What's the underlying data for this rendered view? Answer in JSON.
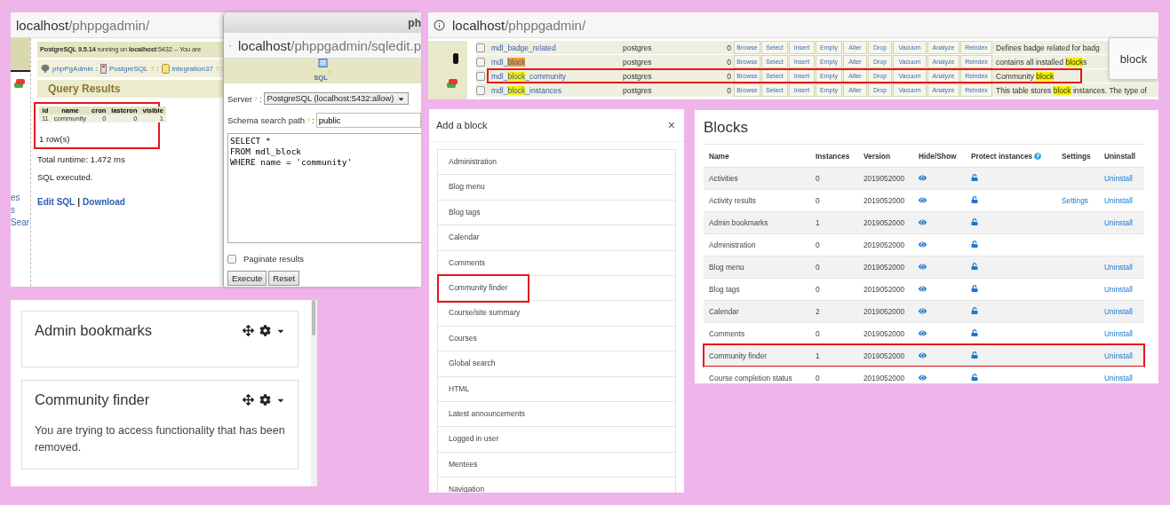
{
  "query_window": {
    "address": {
      "host": "localhost",
      "path": "/phppgadmin/"
    },
    "sidebar_fragments": [
      "es",
      "s",
      "Sear"
    ],
    "banner": "**PostgreSQL 9.5.14** running on **localhost**:5432 -- You are",
    "breadcrumbs": [
      {
        "kind": "app",
        "label": "phpPgAdmin",
        "suffix": ":"
      },
      {
        "kind": "server",
        "label": "PostgreSQL",
        "help": "?",
        "suffix": ":"
      },
      {
        "kind": "database",
        "label": "integration37",
        "help": "?",
        "suffix": ":"
      }
    ],
    "heading": "Query Results",
    "results": {
      "annotated": true,
      "columns": [
        "id",
        "name",
        "cron",
        "lastcron",
        "visible"
      ],
      "rows": [
        [
          "11",
          "community",
          "0",
          "0",
          "1"
        ]
      ],
      "row_count": "1 row(s)"
    },
    "runtime": "Total runtime: 1.472 ms",
    "status": "SQL executed.",
    "links": [
      "Edit SQL",
      "Download"
    ],
    "link_separator": "|"
  },
  "sql_window": {
    "title": "ph",
    "address": {
      "host": "localhost",
      "path": "/phppgadmin/sqledit.p"
    },
    "toolbar": {
      "label": "SQL",
      "help": "?"
    },
    "server": {
      "label": "Server",
      "help": "?",
      "suffix": ":",
      "value": "PostgreSQL (localhost:5432:allow)"
    },
    "schema": {
      "label": "Schema search path",
      "help": "?",
      "suffix": ":",
      "value": "public"
    },
    "query": "SELECT *\nFROM mdl_block\nWHERE name = 'community'",
    "paginate": {
      "label": "Paginate results",
      "checked": false
    },
    "buttons": [
      "Execute",
      "Reset"
    ]
  },
  "tables_window": {
    "address": {
      "host": "localhost",
      "path": "/phppgadmin/"
    },
    "find_text": "block",
    "rows": [
      {
        "checked": false,
        "annotated": false,
        "name": [
          {
            "text": "mdl_badge_related",
            "match": false
          }
        ],
        "owner": "postgres",
        "count": "0",
        "actions": [
          "Browse",
          "Select",
          "Insert",
          "Empty",
          "Alter",
          "Drop",
          "Vacuum",
          "Analyze",
          "Reindex"
        ],
        "comment": [
          {
            "text": "Defines badge related for badg",
            "match": false
          }
        ]
      },
      {
        "checked": false,
        "annotated": false,
        "name": [
          {
            "text": "mdl_",
            "match": false
          },
          {
            "text": "block",
            "match": true,
            "current": true
          }
        ],
        "owner": "postgres",
        "count": "0",
        "actions": [
          "Browse",
          "Select",
          "Insert",
          "Empty",
          "Alter",
          "Drop",
          "Vacuum",
          "Analyze",
          "Reindex"
        ],
        "comment": [
          {
            "text": "contains all installed ",
            "match": false
          },
          {
            "text": "block",
            "match": true,
            "current": false
          },
          {
            "text": "s",
            "match": false
          }
        ]
      },
      {
        "checked": false,
        "annotated": true,
        "name": [
          {
            "text": "mdl_",
            "match": false
          },
          {
            "text": "block",
            "match": true,
            "current": false
          },
          {
            "text": "_community",
            "match": false
          }
        ],
        "owner": "postgres",
        "count": "0",
        "actions": [
          "Browse",
          "Select",
          "Insert",
          "Empty",
          "Alter",
          "Drop",
          "Vacuum",
          "Analyze",
          "Reindex"
        ],
        "comment": [
          {
            "text": "Community ",
            "match": false
          },
          {
            "text": "block",
            "match": true,
            "current": false
          }
        ]
      },
      {
        "checked": false,
        "annotated": false,
        "name": [
          {
            "text": "mdl_",
            "match": false
          },
          {
            "text": "block",
            "match": true,
            "current": false
          },
          {
            "text": "_instances",
            "match": false
          }
        ],
        "owner": "postgres",
        "count": "0",
        "actions": [
          "Browse",
          "Select",
          "Insert",
          "Empty",
          "Alter",
          "Drop",
          "Vacuum",
          "Analyze",
          "Reindex"
        ],
        "comment": [
          {
            "text": "This table stores ",
            "match": false
          },
          {
            "text": "block",
            "match": true,
            "current": false
          },
          {
            "text": " instances. The type of",
            "match": false
          }
        ]
      }
    ]
  },
  "block_cards": [
    {
      "title": "Admin bookmarks"
    },
    {
      "title": "Community finder",
      "body": "You are trying to access functionality that has been removed."
    }
  ],
  "add_block_dialog": {
    "title": "Add a block",
    "close": "×",
    "items": [
      {
        "label": "Administration",
        "annotated": false
      },
      {
        "label": "Blog menu",
        "annotated": false
      },
      {
        "label": "Blog tags",
        "annotated": false
      },
      {
        "label": "Calendar",
        "annotated": false
      },
      {
        "label": "Comments",
        "annotated": false
      },
      {
        "label": "Community finder",
        "annotated": true
      },
      {
        "label": "Course/site summary",
        "annotated": false
      },
      {
        "label": "Courses",
        "annotated": false
      },
      {
        "label": "Global search",
        "annotated": false
      },
      {
        "label": "HTML",
        "annotated": false
      },
      {
        "label": "Latest announcements",
        "annotated": false
      },
      {
        "label": "Logged in user",
        "annotated": false
      },
      {
        "label": "Mentees",
        "annotated": false
      },
      {
        "label": "Navigation",
        "annotated": false
      }
    ]
  },
  "blocks_page": {
    "title": "Blocks",
    "columns": [
      "Name",
      "Instances",
      "Version",
      "Hide/Show",
      "Protect instances",
      "Settings",
      "Uninstall"
    ],
    "rows": [
      {
        "name": "Activities",
        "instances": "0",
        "version": "2019052000",
        "uninstall": "Uninstall",
        "annotated": false
      },
      {
        "name": "Activity results",
        "instances": "0",
        "version": "2019052000",
        "settings": "Settings",
        "uninstall": "Uninstall",
        "annotated": false
      },
      {
        "name": "Admin bookmarks",
        "instances": "1",
        "version": "2019052000",
        "uninstall": "Uninstall",
        "annotated": false
      },
      {
        "name": "Administration",
        "instances": "0",
        "version": "2019052000",
        "annotated": false
      },
      {
        "name": "Blog menu",
        "instances": "0",
        "version": "2019052000",
        "uninstall": "Uninstall",
        "annotated": false
      },
      {
        "name": "Blog tags",
        "instances": "0",
        "version": "2019052000",
        "uninstall": "Uninstall",
        "annotated": false
      },
      {
        "name": "Calendar",
        "instances": "2",
        "version": "2019052000",
        "uninstall": "Uninstall",
        "annotated": false
      },
      {
        "name": "Comments",
        "instances": "0",
        "version": "2019052000",
        "uninstall": "Uninstall",
        "annotated": false
      },
      {
        "name": "Community finder",
        "instances": "1",
        "version": "2019052000",
        "uninstall": "Uninstall",
        "annotated": true
      },
      {
        "name": "Course completion status",
        "instances": "0",
        "version": "2019052000",
        "uninstall": "Uninstall",
        "annotated": false
      }
    ]
  }
}
